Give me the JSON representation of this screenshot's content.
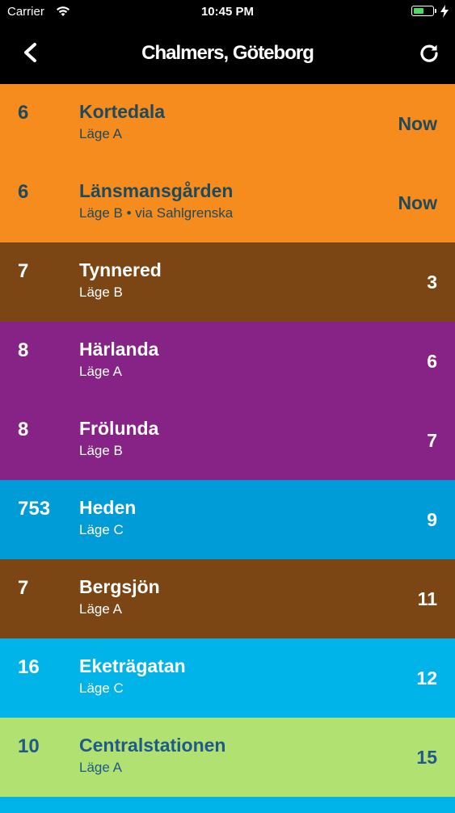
{
  "status_bar": {
    "carrier": "Carrier",
    "time": "10:45 PM",
    "battery_level": 0.55,
    "battery_color": "#4cd964"
  },
  "nav": {
    "title": "Chalmers, Göteborg",
    "back_icon": "chevron-left-icon",
    "refresh_icon": "refresh-icon"
  },
  "departures": [
    {
      "line": "6",
      "destination": "Kortedala",
      "stop": "Läge A",
      "time": "Now",
      "bg": "#f78c1e",
      "fg": "#1e4a5c"
    },
    {
      "line": "6",
      "destination": "Länsmansgården",
      "stop": "Läge B • via Sahlgrenska",
      "time": "Now",
      "bg": "#f78c1e",
      "fg": "#1e4a5c"
    },
    {
      "line": "7",
      "destination": "Tynnered",
      "stop": "Läge B",
      "time": "3",
      "bg": "#7b4514",
      "fg": "#ffffff"
    },
    {
      "line": "8",
      "destination": "Härlanda",
      "stop": "Läge A",
      "time": "6",
      "bg": "#872387",
      "fg": "#ffffff"
    },
    {
      "line": "8",
      "destination": "Frölunda",
      "stop": "Läge B",
      "time": "7",
      "bg": "#872387",
      "fg": "#ffffff"
    },
    {
      "line": "753",
      "destination": "Heden",
      "stop": "Läge C",
      "time": "9",
      "bg": "#009cd8",
      "fg": "#ffffff"
    },
    {
      "line": "7",
      "destination": "Bergsjön",
      "stop": "Läge A",
      "time": "11",
      "bg": "#7b4514",
      "fg": "#ffffff"
    },
    {
      "line": "16",
      "destination": "Eketrägatan",
      "stop": "Läge C",
      "time": "12",
      "bg": "#00b4ea",
      "fg": "#ffffff"
    },
    {
      "line": "10",
      "destination": "Centralstationen",
      "stop": "Läge A",
      "time": "15",
      "bg": "#b1e170",
      "fg": "#1e5a8a"
    }
  ],
  "tail_color": "#00b4ea"
}
